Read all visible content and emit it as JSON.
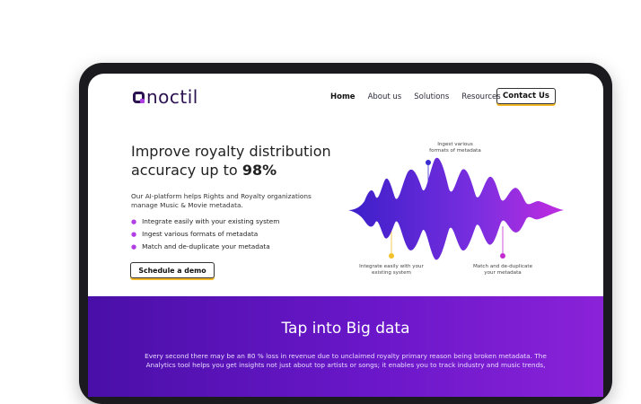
{
  "header": {
    "logo_text": "noctil",
    "nav": [
      "Home",
      "About us",
      "Solutions",
      "Resources"
    ],
    "contact_label": "Contact Us"
  },
  "hero": {
    "title_part1": "Improve royalty distribution accuracy up to ",
    "title_highlight": "98%",
    "description": "Our AI-platform helps Rights and Royalty organizations manage Music & Movie metadata.",
    "bullets": [
      "Integrate easily with your existing system",
      "Ingest various formats of metadata",
      "Match and de-duplicate your metadata"
    ],
    "demo_label": "Schedule a demo"
  },
  "illustration": {
    "label_top": "Ingest various formats of metadata",
    "label_left": "Integrate easily with your existing system",
    "label_right": "Match and de-duplicate your metadata",
    "colors": {
      "wave_start": "#3b1fc9",
      "wave_end": "#c02ce0",
      "dot_top": "#3a2bd0",
      "dot_left": "#f3c22a",
      "dot_right": "#c22ccf"
    }
  },
  "big_data": {
    "title": "Tap into Big data",
    "text": "Every second there may be an 80 % loss in revenue due to unclaimed royalty primary reason being broken metadata. The Analytics tool helps you get insights not just about top artists or songs; it enables you to track industry and music trends,"
  },
  "colors": {
    "accent_purple": "#b13fe3",
    "button_underline": "#f3b82a",
    "section_bg": "#5a14b8"
  }
}
